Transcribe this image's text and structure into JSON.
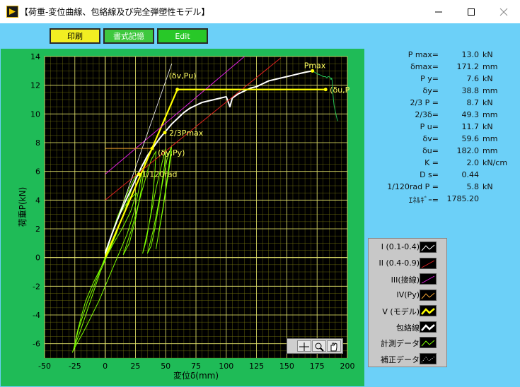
{
  "window": {
    "title": "【荷重-変位曲線、包絡線及び完全弾塑性モデル】"
  },
  "toolbar": {
    "print_label": "印刷",
    "format_label": "書式記憶",
    "edit_label": "Edit"
  },
  "readout": [
    {
      "label": "P max=",
      "value": "13.0",
      "unit": "kN"
    },
    {
      "label": "δmax=",
      "value": "171.2",
      "unit": "mm"
    },
    {
      "label": "P y=",
      "value": "7.6",
      "unit": "kN"
    },
    {
      "label": "δy=",
      "value": "38.8",
      "unit": "mm"
    },
    {
      "label": "2/3 P =",
      "value": "8.7",
      "unit": "kN"
    },
    {
      "label": "2/3δ=",
      "value": "49.3",
      "unit": "mm"
    },
    {
      "label": "P u=",
      "value": "11.7",
      "unit": "kN"
    },
    {
      "label": "δv=",
      "value": "59.6",
      "unit": "mm"
    },
    {
      "label": "δu=",
      "value": "182.0",
      "unit": "mm"
    },
    {
      "label": "K =",
      "value": "2.0",
      "unit": "kN/cm"
    },
    {
      "label": "D s=",
      "value": "0.44",
      "unit": ""
    },
    {
      "label": "1/120rad P =",
      "value": "5.8",
      "unit": "kN"
    },
    {
      "label": "ｴﾈﾙｷﾞｰ=",
      "value": "1785.20",
      "unit": ""
    }
  ],
  "legend": [
    {
      "label": "I (0.1-0.4)",
      "color": "#ffffff",
      "style": "zigzag"
    },
    {
      "label": "II (0.4-0.9)",
      "color": "#e02020",
      "style": "line"
    },
    {
      "label": "III(接線)",
      "color": "#e020e0",
      "style": "line"
    },
    {
      "label": "IV(Py)",
      "color": "#f0a030",
      "style": "zigzag"
    },
    {
      "label": "V (モデル)",
      "color": "#ffff00",
      "style": "thick"
    },
    {
      "label": "包絡線",
      "color": "#ffffff",
      "style": "thick"
    },
    {
      "label": "計測データ",
      "color": "#7cfc00",
      "style": "zigzag"
    },
    {
      "label": "補正データ",
      "color": "#ffffff",
      "style": "dotted"
    }
  ],
  "chart_data": {
    "type": "line",
    "xlabel": "変位δ(mm)",
    "ylabel": "荷重P(kN)",
    "xlim": [
      -50,
      200
    ],
    "ylim": [
      -7,
      14
    ],
    "xticks": [
      -50,
      -25,
      0,
      25,
      50,
      75,
      100,
      125,
      150,
      175,
      200
    ],
    "yticks": [
      -6,
      -4,
      -2,
      0,
      2,
      4,
      6,
      8,
      10,
      12,
      14
    ],
    "grid": true,
    "annotations": [
      {
        "text": "Pmax",
        "x": 171.2,
        "y": 13.0
      },
      {
        "text": "(δv,Pu)",
        "x": 59.6,
        "y": 11.7
      },
      {
        "text": "(δu,P",
        "x": 182.0,
        "y": 11.7
      },
      {
        "text": "2/3Pmax",
        "x": 49.3,
        "y": 8.7
      },
      {
        "text": "(δy,Py)",
        "x": 38.8,
        "y": 7.6
      },
      {
        "text": "1/120rad",
        "x": 28,
        "y": 5.8
      }
    ],
    "series": [
      {
        "name": "計測データ",
        "color": "#7cfc00",
        "x": [
          0,
          3,
          7,
          12,
          18,
          22,
          26,
          21,
          14,
          7,
          2,
          -4,
          -10,
          -16,
          -20,
          -23,
          -25,
          -26,
          -22,
          -15,
          -7,
          -1,
          3,
          6,
          10,
          15,
          20,
          24,
          28,
          31,
          28,
          24,
          18,
          12,
          7,
          1,
          -5,
          -12,
          -18,
          -24,
          -27,
          -20,
          -12,
          -4,
          3,
          9,
          16,
          22,
          27,
          31,
          33,
          30,
          25,
          20,
          15,
          22,
          30,
          35,
          38,
          42,
          41,
          38,
          34,
          31,
          36,
          42,
          47,
          50,
          49,
          45,
          41,
          38,
          35,
          40,
          46,
          51,
          55,
          52,
          48,
          44,
          42,
          48,
          55
        ],
        "y": [
          0.2,
          1.0,
          2.0,
          3.0,
          3.8,
          4.2,
          4.5,
          3.2,
          2.0,
          1.0,
          0.2,
          -0.8,
          -1.8,
          -3.0,
          -4.2,
          -5.2,
          -6.0,
          -6.4,
          -5.0,
          -3.2,
          -1.5,
          -0.2,
          0.8,
          1.8,
          2.8,
          3.8,
          4.8,
          5.5,
          6.0,
          6.2,
          4.8,
          3.2,
          1.6,
          0.4,
          -0.6,
          -1.8,
          -3.0,
          -4.2,
          -5.2,
          -6.1,
          -6.6,
          -5.0,
          -3.0,
          -1.0,
          0.4,
          1.6,
          3.2,
          4.8,
          5.8,
          6.5,
          6.8,
          4.8,
          2.6,
          1.0,
          0.2,
          2.0,
          4.5,
          6.0,
          6.8,
          7.4,
          5.8,
          3.2,
          1.2,
          0.3,
          2.2,
          4.8,
          6.6,
          7.6,
          6.4,
          4.0,
          2.0,
          0.8,
          0.3,
          2.0,
          4.6,
          6.8,
          7.8,
          6.0,
          3.6,
          1.6,
          0.6,
          3.5,
          7.4
        ]
      },
      {
        "name": "包絡線",
        "color": "#ffffff",
        "x": [
          0,
          5,
          10,
          15,
          20,
          25,
          30,
          35,
          40,
          45,
          50,
          55,
          60,
          65,
          70,
          75,
          80,
          85,
          90,
          95,
          100,
          103,
          105,
          110,
          115,
          120,
          125,
          130,
          135,
          140,
          145,
          150,
          155,
          160,
          165,
          171.2
        ],
        "y": [
          0.3,
          1.5,
          2.6,
          3.6,
          4.5,
          5.4,
          6.3,
          7.1,
          7.7,
          8.3,
          8.8,
          9.3,
          9.7,
          10.1,
          10.4,
          10.6,
          10.8,
          10.9,
          11.0,
          11.1,
          11.2,
          10.5,
          11.1,
          11.4,
          11.6,
          11.8,
          11.9,
          12.1,
          12.3,
          12.4,
          12.5,
          12.6,
          12.7,
          12.8,
          12.9,
          13.0
        ]
      },
      {
        "name": "補正データ",
        "color": "#22c055",
        "x": [
          171.2,
          175,
          178,
          180,
          182,
          183,
          184,
          185,
          186,
          186.5,
          187,
          187.5,
          188,
          188.5,
          189,
          190,
          191,
          192
        ],
        "y": [
          13.0,
          12.8,
          12.7,
          12.6,
          12.6,
          12.5,
          12.6,
          12.6,
          12.5,
          12.4,
          12.5,
          12.3,
          11.5,
          11.0,
          10.6,
          10.2,
          9.8,
          9.5
        ]
      },
      {
        "name": "V (モデル)",
        "color": "#ffff00",
        "x": [
          0,
          59.6,
          182.0
        ],
        "y": [
          0,
          11.7,
          11.7
        ]
      },
      {
        "name": "II (0.4-0.9)",
        "color": "#e02020",
        "x": [
          0,
          145
        ],
        "y": [
          4.0,
          13.9
        ]
      },
      {
        "name": "III(接線)",
        "color": "#e020e0",
        "x": [
          0,
          115
        ],
        "y": [
          5.8,
          14.0
        ]
      },
      {
        "name": "I (0.1-0.4)",
        "color": "#ffffff",
        "x": [
          0,
          55
        ],
        "y": [
          0.2,
          13.5
        ]
      },
      {
        "name": "IV(Py)",
        "color": "#f0a030",
        "x": [
          0,
          38.8
        ],
        "y": [
          7.6,
          7.6
        ]
      }
    ]
  }
}
